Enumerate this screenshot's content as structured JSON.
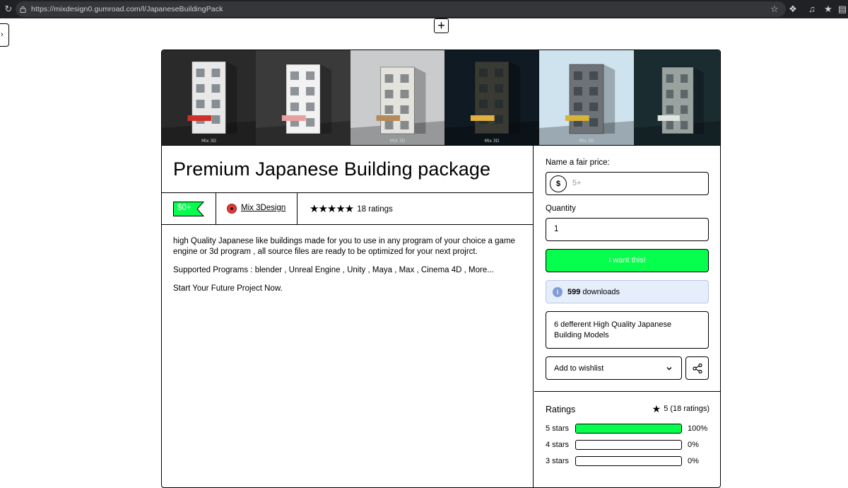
{
  "browser": {
    "url": "https://mixdesign0.gumroad.com/l/JapaneseBuildingPack"
  },
  "product": {
    "title": "Premium Japanese Building package",
    "price_tag": "$0+",
    "creator": "Mix 3Design",
    "rating_text": "18 ratings",
    "stars": "★★★★★",
    "description": [
      "high Quality Japanese like buildings made for you to use in any program of your choice a game engine or 3d program , all source files are ready to be optimized for your next projrct.",
      "Supported Programs : blender , Unreal Engine , Unity , Maya , Max , Cinema 4D , More...",
      "Start Your Future Project Now."
    ],
    "gallery": [
      {
        "caption": "Mix 3D",
        "sky": "#2a2a2a",
        "building": "#e8e8e8",
        "accent": "#d0302a"
      },
      {
        "caption": "",
        "sky": "#3a3a3a",
        "building": "#f2f2f2",
        "accent": "#e7a0a0"
      },
      {
        "caption": "MIX 3D",
        "sky": "#c9cbcc",
        "building": "#e4e2dc",
        "accent": "#b68a5a"
      },
      {
        "caption": "Mix 3D",
        "sky": "#0f1a22",
        "building": "#3a3a34",
        "accent": "#e0b040"
      },
      {
        "caption": "Mix 3D",
        "sky": "#cfe3ee",
        "building": "#6c7276",
        "accent": "#d8b33a"
      },
      {
        "caption": "",
        "sky": "#1b2c30",
        "building": "#9aa2a0",
        "accent": "#dfe6e0"
      }
    ]
  },
  "purchase": {
    "price_label": "Name a fair price:",
    "currency_symbol": "$",
    "price_placeholder": "5+",
    "quantity_label": "Quantity",
    "quantity_value": "1",
    "buy_label": "I want this!",
    "downloads_count": "599",
    "downloads_label": "downloads",
    "summary": "6 defferent High Quality Japanese Building Models",
    "wishlist_label": "Add to wishlist"
  },
  "ratings": {
    "title": "Ratings",
    "summary": "5 (18 ratings)",
    "rows": [
      {
        "label": "5 stars",
        "percent": "100%",
        "fill": 1.0
      },
      {
        "label": "4 stars",
        "percent": "0%",
        "fill": 0
      },
      {
        "label": "3 stars",
        "percent": "0%",
        "fill": 0
      }
    ]
  },
  "colors": {
    "accent_green": "#05ff4c",
    "info_blue": "#e6edfb"
  }
}
